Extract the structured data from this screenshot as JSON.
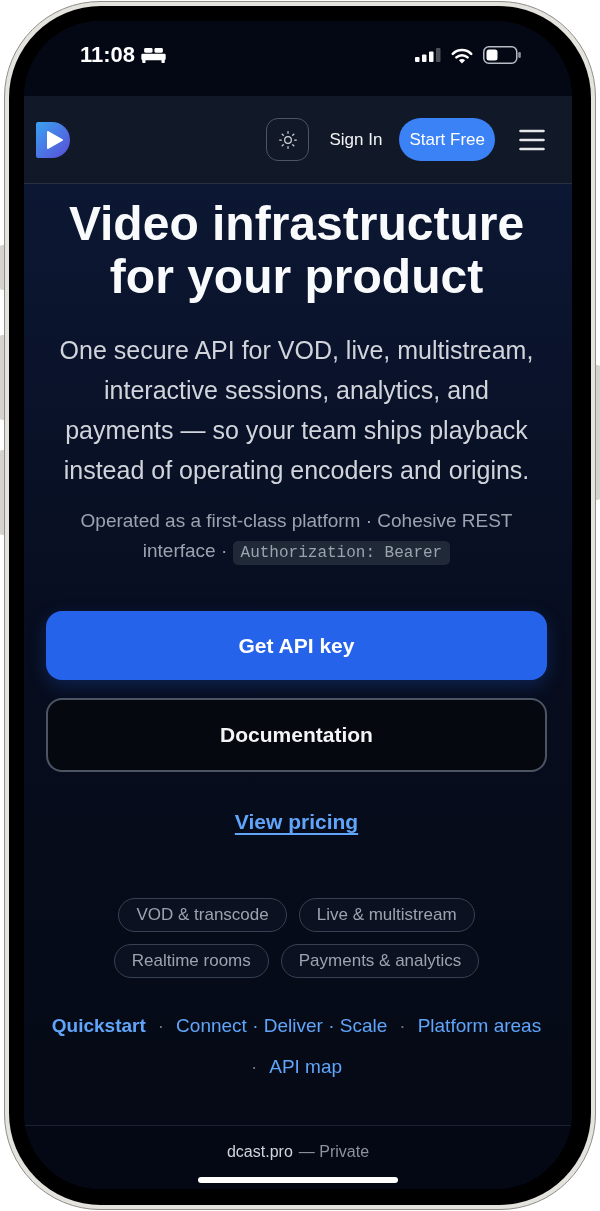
{
  "status_bar": {
    "time": "11:08"
  },
  "navbar": {
    "sign_in": "Sign In",
    "cta": "Start Free"
  },
  "hero": {
    "title": "Video infrastructure for your product",
    "description": "One secure API for VOD, live, multistream, interactive sessions, analytics, and payments — so your team ships playback instead of operating encoders and origins.",
    "note": {
      "text": "Operated as a first-class platform · Cohesive REST interface ·",
      "code": "Authorization: Bearer"
    }
  },
  "actions": [
    {
      "kind": "primary",
      "label": "Get API key"
    },
    {
      "kind": "outline",
      "label": "Documentation"
    },
    {
      "kind": "link",
      "label": "View pricing"
    }
  ],
  "tags": [
    "VOD & transcode",
    "Live & multistream",
    "Realtime rooms",
    "Payments & analytics"
  ],
  "footer_links": [
    {
      "label": "Quickstart",
      "bold": true
    },
    {
      "separator": "·",
      "label": "Connect · Deliver · Scale",
      "bold": false
    },
    {
      "separator": "·",
      "label": "Platform areas",
      "bold": false
    },
    {
      "separator": "·",
      "label": "API map",
      "bold": false
    }
  ],
  "browser_bar": {
    "domain": "dcast.pro",
    "suffix": "— Private"
  }
}
